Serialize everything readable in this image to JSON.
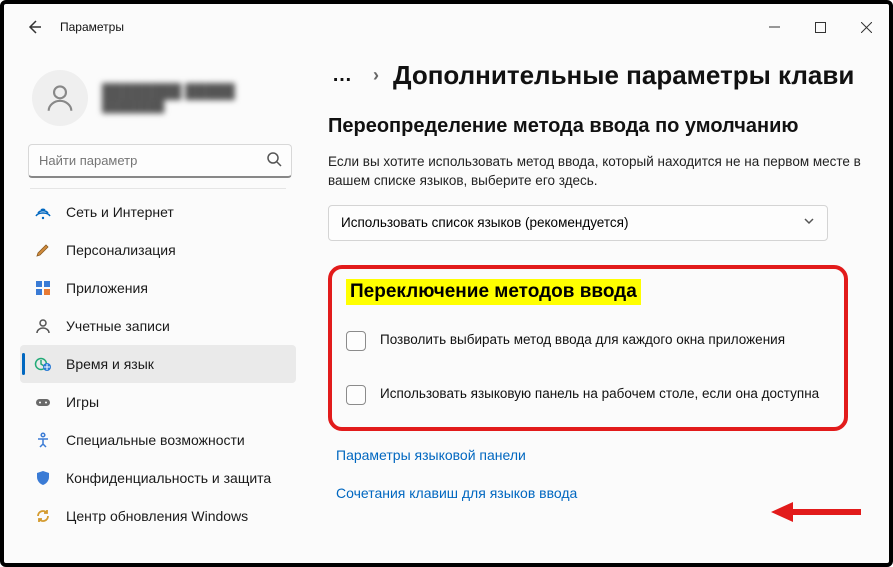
{
  "titlebar": {
    "title": "Параметры"
  },
  "profile": {
    "name": "████████ █████",
    "email": "████████"
  },
  "search": {
    "placeholder": "Найти параметр"
  },
  "nav": {
    "items": [
      {
        "label": "Сеть и Интернет",
        "icon": "network"
      },
      {
        "label": "Персонализация",
        "icon": "brush"
      },
      {
        "label": "Приложения",
        "icon": "apps"
      },
      {
        "label": "Учетные записи",
        "icon": "person"
      },
      {
        "label": "Время и язык",
        "icon": "timelang",
        "selected": true
      },
      {
        "label": "Игры",
        "icon": "games"
      },
      {
        "label": "Специальные возможности",
        "icon": "access"
      },
      {
        "label": "Конфиденциальность и защита",
        "icon": "shield"
      },
      {
        "label": "Центр обновления Windows",
        "icon": "update"
      }
    ]
  },
  "breadcrumb": {
    "title": "Дополнительные параметры клави"
  },
  "override": {
    "heading": "Переопределение метода ввода по умолчанию",
    "desc": "Если вы хотите использовать метод ввода, который находится не на первом месте в вашем списке языков, выберите его здесь.",
    "selected": "Использовать список языков (рекомендуется)"
  },
  "switching": {
    "heading": "Переключение методов ввода",
    "opt1": "Позволить выбирать метод ввода для каждого окна приложения",
    "opt2": "Использовать языковую панель на рабочем столе, если она доступна",
    "link1": "Параметры языковой панели",
    "link2": "Сочетания клавиш для языков ввода"
  }
}
